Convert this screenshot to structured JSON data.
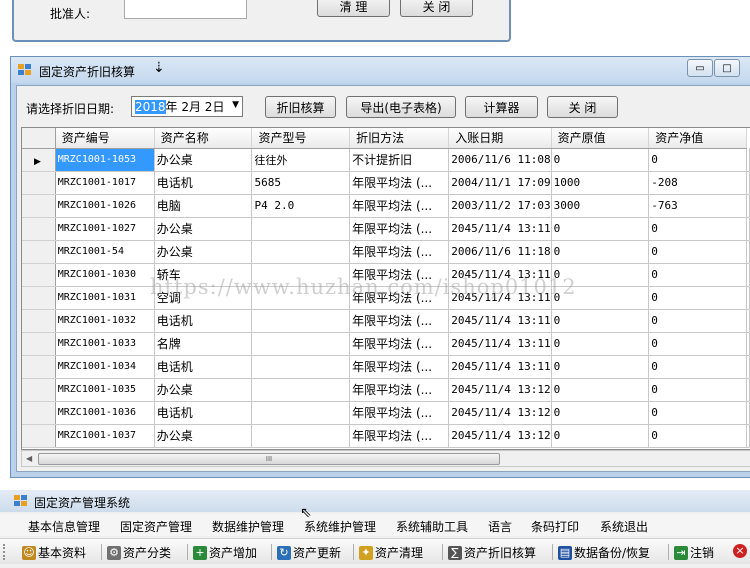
{
  "top_dialog": {
    "approver_label": "批准人:",
    "clear_label": "清  理",
    "close_label": "关  闭"
  },
  "depreciation_window": {
    "title": "固定资产折旧核算",
    "minimize_glyph": "▭",
    "restore_glyph": "□",
    "date_label": "请选择折旧日期:",
    "date_year": "2018",
    "date_rest": "年  2月  2日",
    "buttons": {
      "calculate": "折旧核算",
      "export": "导出(电子表格)",
      "calculator": "计算器",
      "close": "关  闭"
    },
    "columns": [
      "资产编号",
      "资产名称",
      "资产型号",
      "折旧方法",
      "入账日期",
      "资产原值",
      "资产净值"
    ],
    "rows": [
      [
        "MRZC1001-1053",
        "办公桌",
        "往往外",
        "不计提折旧",
        "2006/11/6 11:08",
        "0",
        "0"
      ],
      [
        "MRZC1001-1017",
        "电话机",
        "5685",
        "年限平均法 (...",
        "2004/11/1 17:09",
        "1000",
        "-208"
      ],
      [
        "MRZC1001-1026",
        "电脑",
        "P4 2.0",
        "年限平均法 (...",
        "2003/11/2 17:03",
        "3000",
        "-763"
      ],
      [
        "MRZC1001-1027",
        "办公桌",
        "",
        "年限平均法 (...",
        "2045/11/4 13:11",
        "0",
        "0"
      ],
      [
        "MRZC1001-54",
        "办公桌",
        "",
        "年限平均法 (...",
        "2006/11/6 11:18",
        "0",
        "0"
      ],
      [
        "MRZC1001-1030",
        "轿车",
        "",
        "年限平均法 (...",
        "2045/11/4 13:11",
        "0",
        "0"
      ],
      [
        "MRZC1001-1031",
        "空调",
        "",
        "年限平均法 (...",
        "2045/11/4 13:11",
        "0",
        "0"
      ],
      [
        "MRZC1001-1032",
        "电话机",
        "",
        "年限平均法 (...",
        "2045/11/4 13:11",
        "0",
        "0"
      ],
      [
        "MRZC1001-1033",
        "名牌",
        "",
        "年限平均法 (...",
        "2045/11/4 13:11",
        "0",
        "0"
      ],
      [
        "MRZC1001-1034",
        "电话机",
        "",
        "年限平均法 (...",
        "2045/11/4 13:11",
        "0",
        "0"
      ],
      [
        "MRZC1001-1035",
        "办公桌",
        "",
        "年限平均法 (...",
        "2045/11/4 13:12",
        "0",
        "0"
      ],
      [
        "MRZC1001-1036",
        "电话机",
        "",
        "年限平均法 (...",
        "2045/11/4 13:12",
        "0",
        "0"
      ],
      [
        "MRZC1001-1037",
        "办公桌",
        "",
        "年限平均法 (...",
        "2045/11/4 13:12",
        "0",
        "0"
      ]
    ],
    "scroll_grip": "III"
  },
  "main_window": {
    "title": "固定资产管理系统",
    "menu": [
      "基本信息管理",
      "固定资产管理",
      "数据维护管理",
      "系统维护管理",
      "系统辅助工具",
      "语言",
      "条码打印",
      "系统退出"
    ],
    "toolbar": [
      {
        "label": "基本资料",
        "icon": "people-icon",
        "color": "#c08a20"
      },
      {
        "label": "资产分类",
        "icon": "gear-icon",
        "color": "#707070"
      },
      {
        "label": "资产增加",
        "icon": "add-icon",
        "color": "#2a8a3a"
      },
      {
        "label": "资产更新",
        "icon": "refresh-icon",
        "color": "#2a6fb8"
      },
      {
        "label": "资产清理",
        "icon": "clean-icon",
        "color": "#d0a020"
      },
      {
        "label": "资产折旧核算",
        "icon": "calc-icon",
        "color": "#555555"
      },
      {
        "label": "数据备份/恢复",
        "icon": "backup-icon",
        "color": "#2050a0"
      },
      {
        "label": "注销",
        "icon": "logout-icon",
        "color": "#2a8a3a"
      }
    ]
  },
  "watermark": "https://www.huzhan.com/ishop01012",
  "colors": {
    "selection": "#3399ff",
    "window_border": "#6d90b8",
    "close_icon": "#cc2222"
  }
}
